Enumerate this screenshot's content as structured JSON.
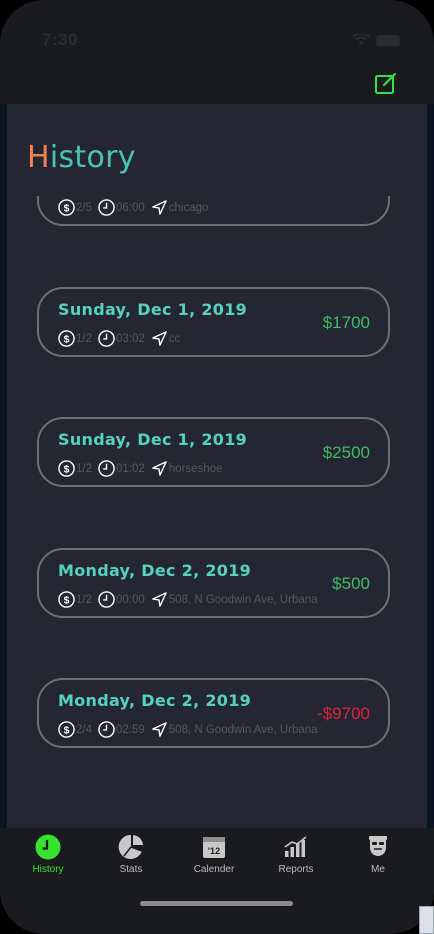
{
  "status_bar": {
    "time": "7:30"
  },
  "header": {
    "title_first_letter": "H",
    "title_rest": "istory"
  },
  "entries": [
    {
      "date": "",
      "ratio": "2/5",
      "time": "06:00",
      "location": "chicago",
      "amount": "",
      "sign": "positive"
    },
    {
      "date": "Sunday, Dec 1, 2019",
      "ratio": "1/2",
      "time": "03:02",
      "location": "cc",
      "amount": "$1700",
      "sign": "positive"
    },
    {
      "date": "Sunday, Dec 1, 2019",
      "ratio": "1/2",
      "time": "01:02",
      "location": "horseshoe",
      "amount": "$2500",
      "sign": "positive"
    },
    {
      "date": "Monday, Dec 2, 2019",
      "ratio": "1/2",
      "time": "00:00",
      "location": "508, N Goodwin Ave, Urbana",
      "amount": "$500",
      "sign": "positive"
    },
    {
      "date": "Monday, Dec 2, 2019",
      "ratio": "2/4",
      "time": "02:59",
      "location": "508, N Goodwin Ave, Urbana",
      "amount": "-$9700",
      "sign": "negative"
    }
  ],
  "tabs": [
    {
      "label": "History",
      "icon": "clock-icon",
      "active": true
    },
    {
      "label": "Stats",
      "icon": "pie-chart-icon",
      "active": false
    },
    {
      "label": "Calender",
      "icon": "calendar-icon",
      "active": false
    },
    {
      "label": "Reports",
      "icon": "bar-chart-icon",
      "active": false
    },
    {
      "label": "Me",
      "icon": "user-avatar-icon",
      "active": false
    }
  ],
  "colors": {
    "title_accent": "#f0804e",
    "title": "#48c3b4",
    "date": "#55d1c0",
    "amount_positive": "#3fbb62",
    "amount_negative": "#e0223c",
    "tab_active": "#38e030"
  }
}
